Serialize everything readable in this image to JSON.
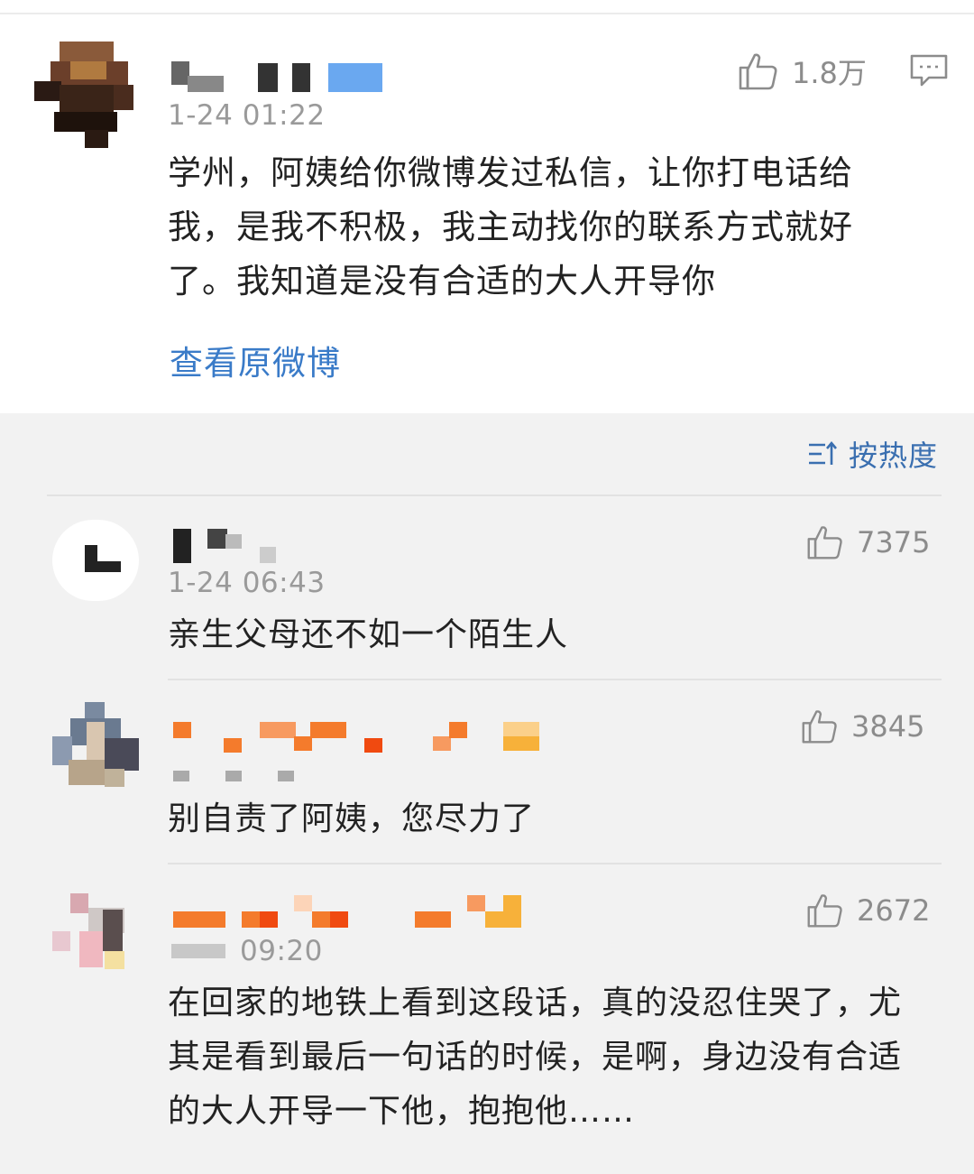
{
  "main_post": {
    "timestamp": "1-24 01:22",
    "likes": "1.8万",
    "text": "学州，阿姨给你微博发过私信，让你打电话给我，是我不积极，我主动找你的联系方式就好了。我知道是没有合适的大人开导你",
    "view_original_label": "查看原微博"
  },
  "sort": {
    "label": "按热度"
  },
  "comments": [
    {
      "timestamp": "1-24 06:43",
      "likes": "7375",
      "text": "亲生父母还不如一个陌生人"
    },
    {
      "likes": "3845",
      "text": "别自责了阿姨，您尽力了"
    },
    {
      "timestamp": "09:20",
      "likes": "2672",
      "text": "在回家的地铁上看到这段话，真的没忍住哭了，尤其是看到最后一句话的时候，是啊，身边没有合适的大人开导一下他，抱抱他……"
    }
  ],
  "icons": {
    "like": "thumbs-up-icon",
    "comment": "comment-icon",
    "sort": "sort-icon"
  },
  "colors": {
    "link": "#3a7bc8",
    "orange": "#f47b2c",
    "meta": "#9a9a9a"
  }
}
